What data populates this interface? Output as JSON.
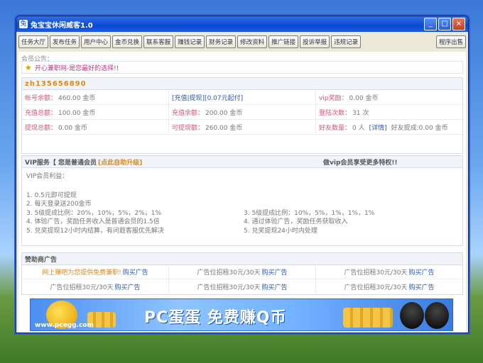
{
  "window": {
    "title": "兔宝宝休闲威客1.0",
    "controls": [
      "_",
      "□",
      "×"
    ]
  },
  "toolbar": {
    "buttons": [
      "任务大厅",
      "发布任务",
      "用户中心",
      "金币兑换",
      "联系客服",
      "赚钱记录",
      "财务记录",
      "修改资料",
      "推广链接",
      "投诉举报",
      "违规记录"
    ],
    "right_button": "程序出售"
  },
  "notice": {
    "label": "会员公告：",
    "text": "开心兼职网-是您最好的选择!!"
  },
  "user": {
    "username": "zh135656890",
    "rows": [
      [
        {
          "label": "帐号余额：",
          "value": "460.00 金币"
        },
        {
          "label": "[充值|提现][0.07元起付]",
          "value": ""
        },
        {
          "label": "vip奖励：",
          "value": "0.00 金币"
        }
      ],
      [
        {
          "label": "充值总额：",
          "value": "100.00 金币"
        },
        {
          "label": "充值余额：",
          "value": "200.00 金币"
        },
        {
          "label": "登陆次数：",
          "value": "31 次"
        }
      ],
      [
        {
          "label": "提现总额：",
          "value": "0.00 金币"
        },
        {
          "label": "可提现额：",
          "value": "260.00 金币"
        },
        {
          "label": "好友数量：",
          "value": "0 人"
        }
      ]
    ],
    "detail_link": "[详情]",
    "friend_withdraw": "好友提成:0.00 金币"
  },
  "vip": {
    "title": "VIP服务【 您是普通会员",
    "upgrade": "[点此自助升级]",
    "invite": "做vip会员享受更多特权!!",
    "rights_label": "VIP会员利益：",
    "left_rules": [
      "1. 0.5元即可提现",
      "2. 每天登录送200金币",
      "3. 5级提成比例：20%，10%，5%，2%，1%",
      "4. 体验广告，奖励任务收入是普通会员的1.5倍",
      "5. 兑奖提现12小时内结算，有问题客服优先解决"
    ],
    "right_rules": [
      "3. 5级提成比例：10%，5%，1%，1%，1%",
      "4. 通过体验广告，奖励任务获取收入",
      "5. 兑奖提现24小时内处理"
    ]
  },
  "sponsor": {
    "title": "赞助商广告",
    "rows": [
      [
        {
          "text": "网上赚吧为您提供免费兼职!",
          "buy": "购买广告",
          "highlight": true
        },
        {
          "text": "广告位招租30元/30天",
          "buy": "购买广告"
        },
        {
          "text": "广告位招租30元/30天",
          "buy": "购买广告"
        }
      ],
      [
        {
          "text": "广告位招租30元/30天",
          "buy": "购买广告"
        },
        {
          "text": "广告位招租30元/30天",
          "buy": "购买广告"
        },
        {
          "text": "广告位招租30元/30天",
          "buy": "购买广告"
        }
      ]
    ]
  },
  "banner": {
    "title": "PC蛋蛋  免费赚Q币",
    "url": "www.pcegg.com"
  }
}
